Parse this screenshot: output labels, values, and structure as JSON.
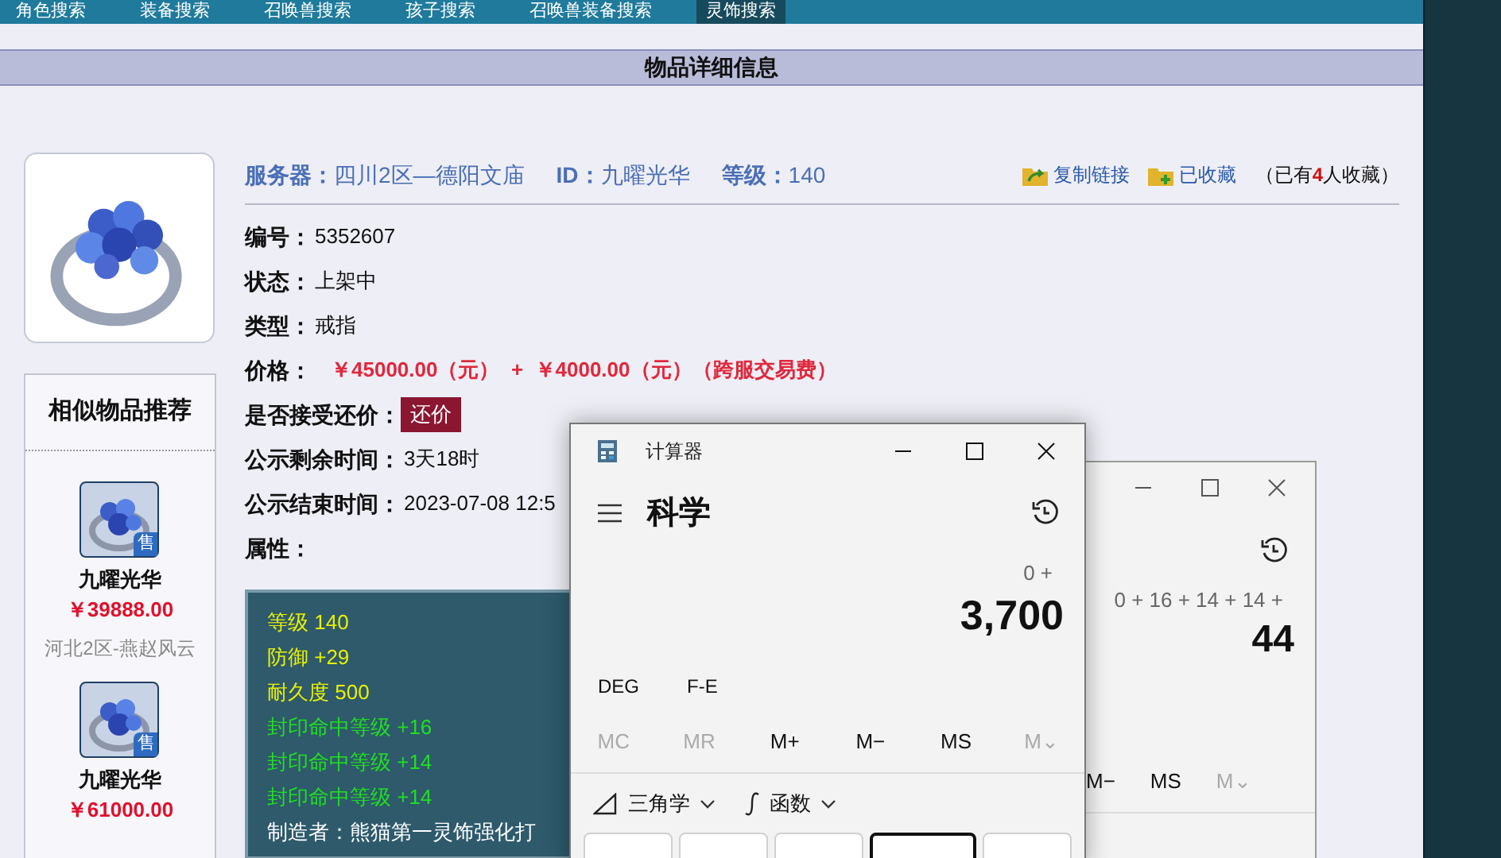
{
  "nav_tabs": [
    {
      "label": "角色搜索",
      "selected": false
    },
    {
      "label": "装备搜索",
      "selected": false
    },
    {
      "label": "召唤兽搜索",
      "selected": false
    },
    {
      "label": "孩子搜索",
      "selected": false
    },
    {
      "label": "召唤兽装备搜索",
      "selected": false
    },
    {
      "label": "灵饰搜索",
      "selected": true
    }
  ],
  "header": {
    "title": "物品详细信息"
  },
  "item_summary": {
    "server_label": "服务器：",
    "server": "四川2区—德阳文庙",
    "id_label": "ID：",
    "id": "九曜光华",
    "level_label": "等级：",
    "level": "140"
  },
  "actions": [
    {
      "kind": "copy",
      "label": "复制链接"
    },
    {
      "kind": "favorite",
      "label": "已收藏"
    }
  ],
  "favorite_count": {
    "prefix": "（已有",
    "count": "4",
    "suffix": "人收藏）"
  },
  "details": [
    {
      "kind": "text",
      "label": "编号：",
      "value": "5352607"
    },
    {
      "kind": "text",
      "label": "状态：",
      "value": " 上架中"
    },
    {
      "kind": "text",
      "label": "类型：",
      "value": "戒指"
    },
    {
      "kind": "price",
      "label": "价格：",
      "value": "￥45000.00（元）  +  ￥4000.00（元）（跨服交易费）"
    },
    {
      "kind": "button",
      "label": "是否接受还价：",
      "value": "还价"
    },
    {
      "kind": "text",
      "label": "公示剩余时间：",
      "value": "3天18时"
    },
    {
      "kind": "text",
      "label": "公示结束时间：",
      "value": "2023-07-08 12:5"
    },
    {
      "kind": "heading",
      "label": "属性："
    }
  ],
  "attributes": [
    {
      "text": "等级 140",
      "color": "#e8f000"
    },
    {
      "text": "防御 +29",
      "color": "#e8f000"
    },
    {
      "text": "耐久度 500",
      "color": "#e8f000"
    },
    {
      "text": "封印命中等级 +16",
      "color": "#22dd22"
    },
    {
      "text": "封印命中等级 +14",
      "color": "#22dd22"
    },
    {
      "text": "封印命中等级 +14",
      "color": "#22dd22"
    },
    {
      "text": "制造者：熊猫第一灵饰强化打",
      "color": "#ffffff"
    }
  ],
  "similar": {
    "title": "相似物品推荐",
    "items": [
      {
        "badge": "售",
        "name": "九曜光华",
        "price": "￥39888.00",
        "server": "河北2区-燕赵风云"
      },
      {
        "badge": "售",
        "name": "九曜光华",
        "price": "￥61000.00"
      }
    ]
  },
  "calculator_back": {
    "expression": "0 + 16 + 14 + 14 +",
    "result": "44",
    "memory": [
      {
        "label": "M−",
        "disabled": false
      },
      {
        "label": "MS",
        "disabled": false
      },
      {
        "label": "M⌄",
        "disabled": true
      }
    ]
  },
  "calculator_front": {
    "title": "计算器",
    "mode": "科学",
    "expression": "0 +",
    "result": "3,700",
    "options": [
      "DEG",
      "F-E"
    ],
    "memory": [
      {
        "label": "MC",
        "disabled": true
      },
      {
        "label": "MR",
        "disabled": true
      },
      {
        "label": "M+",
        "disabled": false
      },
      {
        "label": "M−",
        "disabled": false
      },
      {
        "label": "MS",
        "disabled": false
      },
      {
        "label": "M⌄",
        "disabled": true
      }
    ],
    "menus": [
      {
        "kind": "trig",
        "label": "三角学"
      },
      {
        "kind": "function",
        "label": "函数"
      }
    ]
  }
}
